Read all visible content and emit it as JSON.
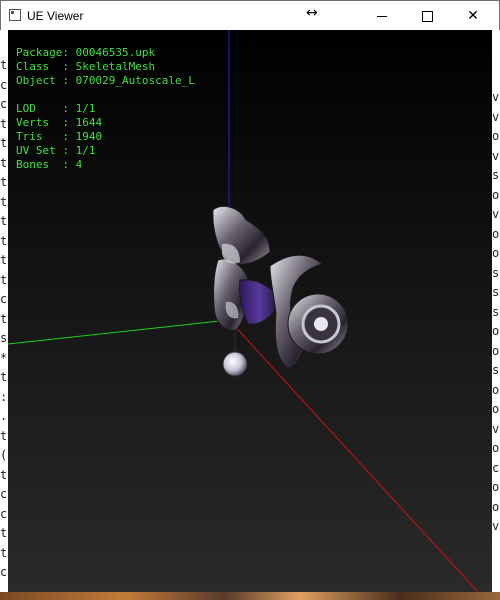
{
  "window": {
    "title": "UE Viewer",
    "resize_glyph": "↔",
    "close_glyph": "✕"
  },
  "info": {
    "package_label": "Package:",
    "package_value": "00046535.upk",
    "class_label": "Class  :",
    "class_value": "SkeletalMesh",
    "object_label": "Object :",
    "object_value": "070029_Autoscale_L",
    "lod_label": "LOD    :",
    "lod_value": "1/1",
    "verts_label": "Verts  :",
    "verts_value": "1644",
    "tris_label": "Tris   :",
    "tris_value": "1940",
    "uvset_label": "UV Set :",
    "uvset_value": "1/1",
    "bones_label": "Bones  :",
    "bones_value": "4"
  },
  "colors": {
    "info_text": "#44e044",
    "axis_x": "#d01010",
    "axis_y": "#20d020",
    "axis_z": "#2020e0",
    "viewport_bg": "#1b1b1b"
  },
  "background_left_glyphs": [
    "t",
    "c",
    "c",
    "t",
    "t",
    "t",
    "t",
    "t",
    "t",
    "t",
    "t",
    "t",
    "c",
    "t",
    "s",
    "*",
    "t",
    ":",
    ".",
    "t",
    "(",
    "t",
    "c",
    "c",
    "t",
    "t",
    "c"
  ],
  "background_right_glyphs": [
    "v",
    "v",
    "o",
    "v",
    "s",
    "o",
    "v",
    "o",
    "o",
    "s",
    "s",
    "s",
    "o",
    "o",
    "s",
    "o",
    "o",
    "v",
    "o",
    "c",
    "o",
    "o",
    "v"
  ]
}
